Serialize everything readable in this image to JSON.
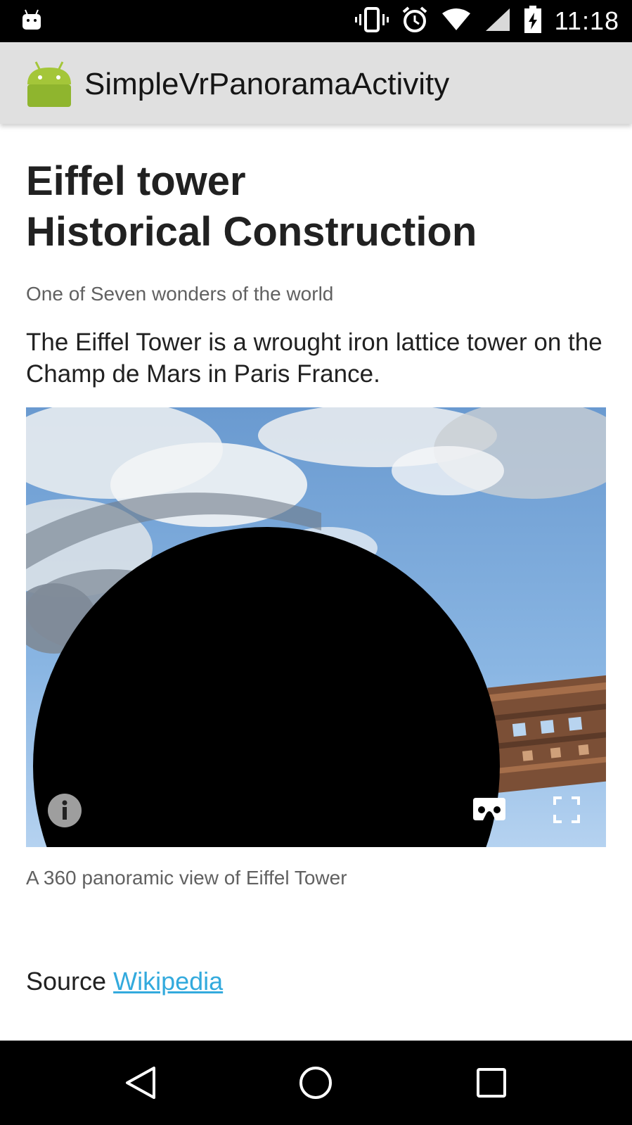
{
  "status_bar": {
    "time": "11:18",
    "icons": [
      "android-notification-icon",
      "vibrate-icon",
      "alarm-icon",
      "wifi-icon",
      "signal-icon",
      "battery-charging-icon"
    ]
  },
  "app_bar": {
    "title": "SimpleVrPanoramaActivity",
    "icon": "android-robot-icon"
  },
  "article": {
    "title_line1": "Eiffel tower",
    "title_line2": "Historical Construction",
    "subtitle": "One of Seven wonders of the world",
    "description": "The Eiffel Tower is a wrought iron lattice tower on the Champ de Mars in Paris France."
  },
  "panorama": {
    "controls": [
      "info-icon",
      "cardboard-vr-icon",
      "fullscreen-icon"
    ]
  },
  "caption": "A 360 panoramic view of Eiffel Tower",
  "source": {
    "label": "Source",
    "link_text": "Wikipedia",
    "link_color": "#33aadd"
  },
  "nav_bar": {
    "buttons": [
      "back-icon",
      "home-icon",
      "recents-icon"
    ]
  }
}
